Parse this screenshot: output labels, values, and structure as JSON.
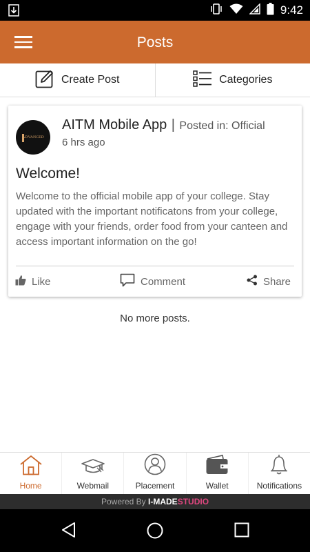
{
  "status_bar": {
    "time": "9:42"
  },
  "app_bar": {
    "title": "Posts"
  },
  "actions": {
    "create_post": "Create Post",
    "categories": "Categories"
  },
  "post": {
    "author": "AITM Mobile App",
    "separator": "|",
    "posted_in": "Posted in: Official",
    "time_ago": "6 hrs ago",
    "title": "Welcome!",
    "body": "Welcome to the official mobile app of your college. Stay updated with the important notificatons from your college, engage with your friends, order food from your canteen and access important information on the go!",
    "like_label": "Like",
    "comment_label": "Comment",
    "share_label": "Share",
    "logo_text": "ADVANCED"
  },
  "feed": {
    "end_text": "No more posts."
  },
  "bottom_nav": {
    "items": [
      {
        "label": "Home",
        "icon": "home-icon",
        "active": true
      },
      {
        "label": "Webmail",
        "icon": "graduation-cap-icon",
        "active": false
      },
      {
        "label": "Placement",
        "icon": "person-icon",
        "active": false
      },
      {
        "label": "Wallet",
        "icon": "wallet-icon",
        "active": false
      },
      {
        "label": "Notifications",
        "icon": "bell-icon",
        "active": false
      }
    ]
  },
  "footer": {
    "powered_prefix": "Powered By",
    "brand_a": "I-MADE",
    "brand_b": "STUDIO"
  },
  "colors": {
    "accent": "#cc6a2e",
    "brand_pink": "#e0477f"
  }
}
